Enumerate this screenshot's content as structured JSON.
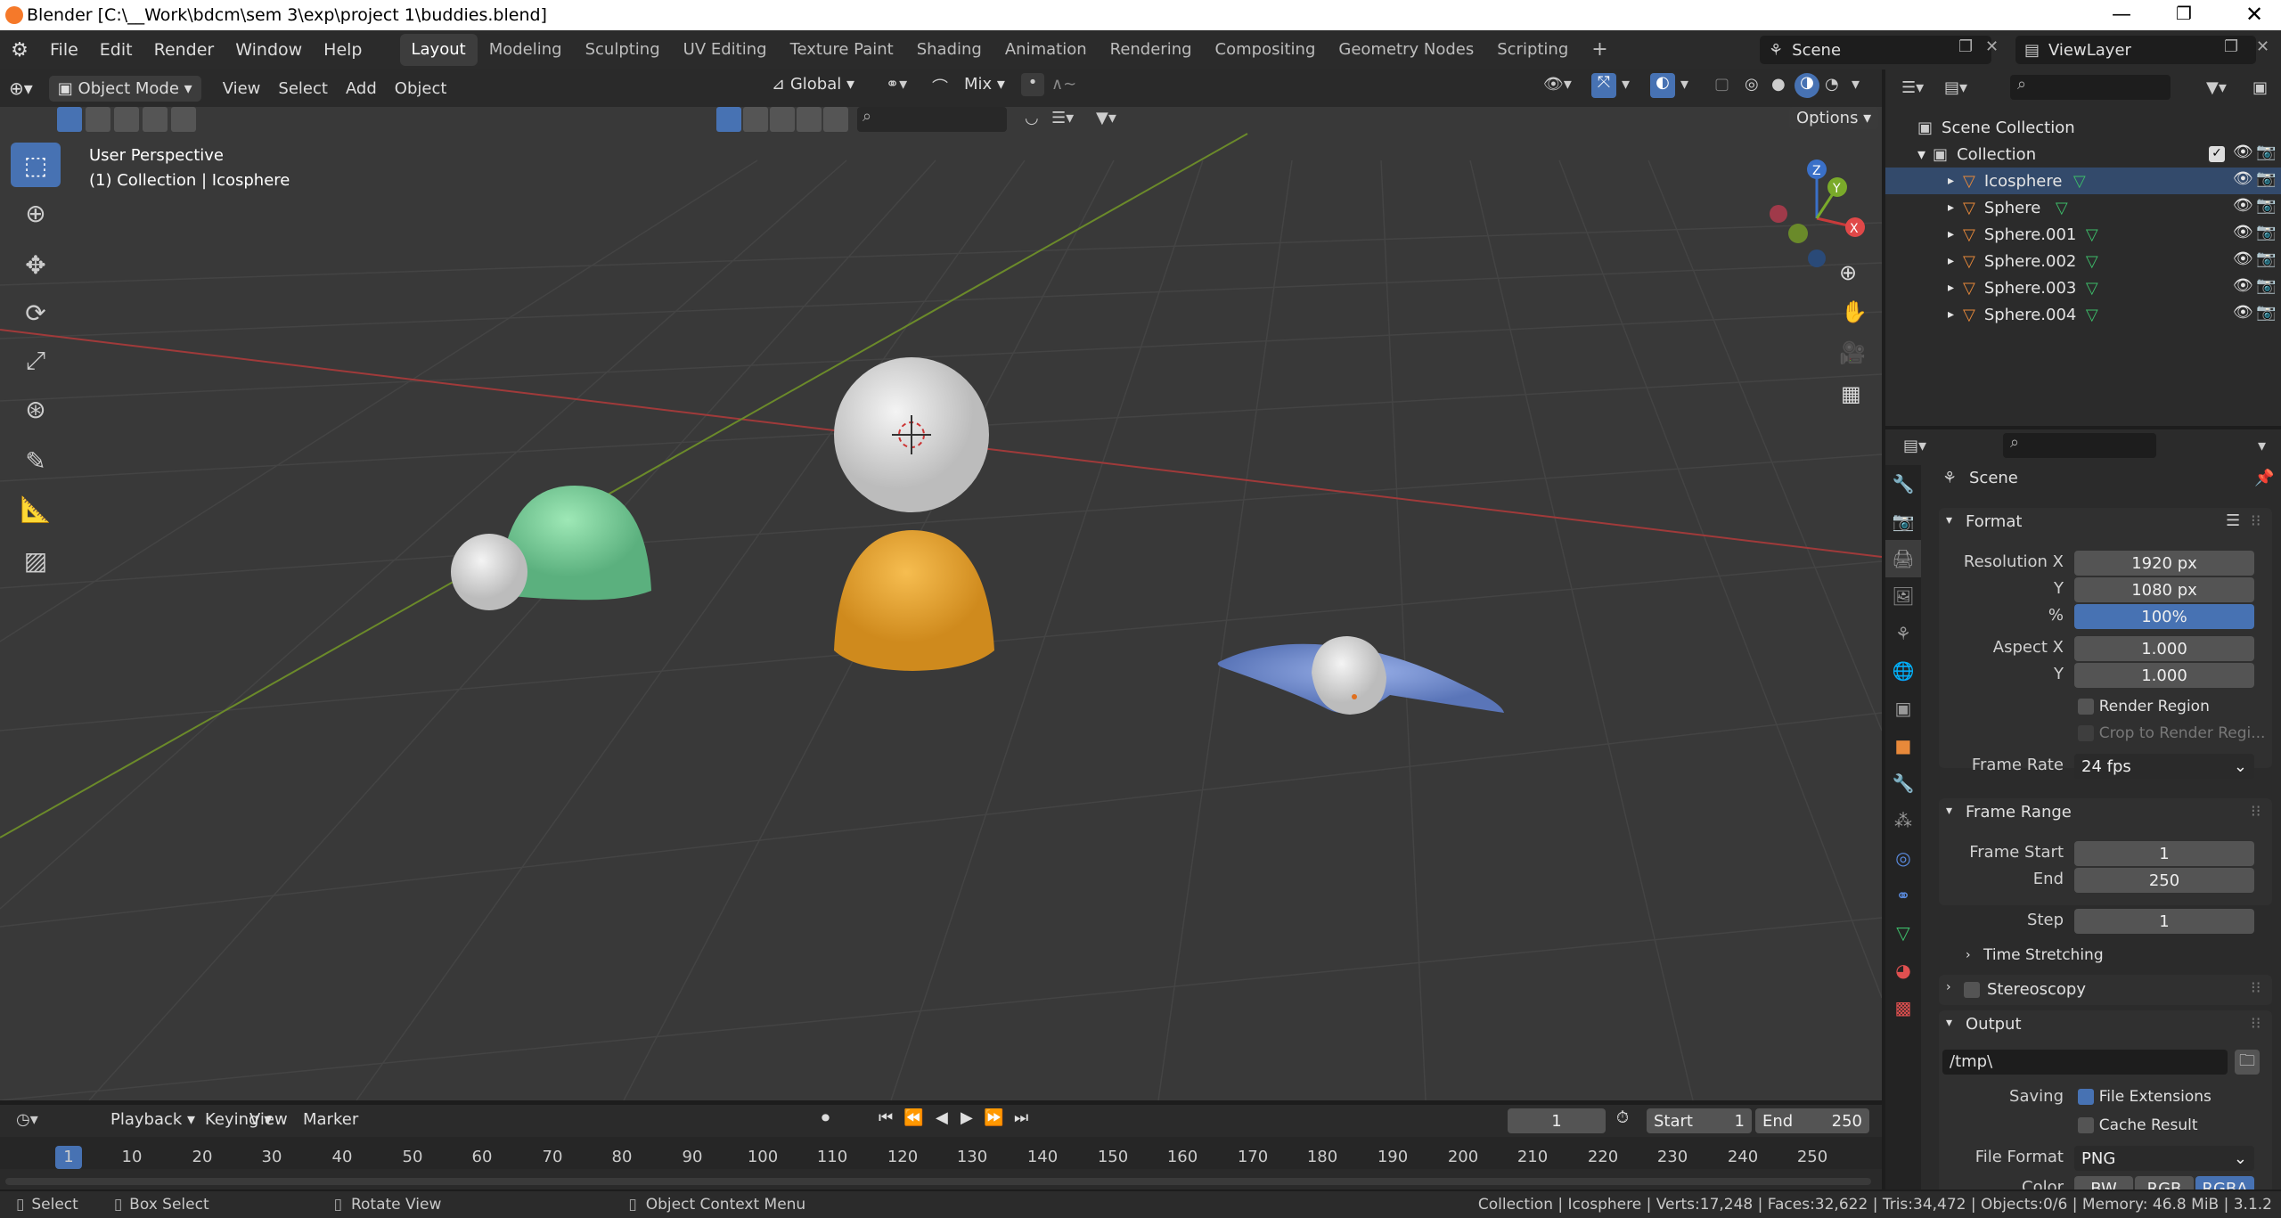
{
  "window": {
    "title": "Blender [C:\\__Work\\bdcm\\sem 3\\exp\\project 1\\buddies.blend]"
  },
  "menu": {
    "items": [
      "File",
      "Edit",
      "Render",
      "Window",
      "Help"
    ]
  },
  "workspaces": [
    "Layout",
    "Modeling",
    "Sculpting",
    "UV Editing",
    "Texture Paint",
    "Shading",
    "Animation",
    "Rendering",
    "Compositing",
    "Geometry Nodes",
    "Scripting"
  ],
  "scene_name": "Scene",
  "view_layer": "ViewLayer",
  "viewport": {
    "mode": "Object Mode",
    "menus": [
      "View",
      "Select",
      "Add",
      "Object"
    ],
    "transform": "Global",
    "snap": "Mix",
    "options": "Options",
    "perspective": "User Perspective",
    "context": "(1) Collection | Icosphere"
  },
  "outliner": {
    "scene_collection": "Scene Collection",
    "collection": "Collection",
    "objects": [
      "Icosphere",
      "Sphere",
      "Sphere.001",
      "Sphere.002",
      "Sphere.003",
      "Sphere.004"
    ]
  },
  "properties": {
    "scene": "Scene",
    "format_title": "Format",
    "resolution_x_label": "Resolution X",
    "resolution_x": "1920 px",
    "y_label": "Y",
    "resolution_y": "1080 px",
    "pct_label": "%",
    "pct": "100%",
    "aspect_x_label": "Aspect X",
    "aspect_x": "1.000",
    "aspect_y": "1.000",
    "render_region": "Render Region",
    "crop": "Crop to Render Regi...",
    "frame_rate_label": "Frame Rate",
    "frame_rate": "24 fps",
    "frame_range_title": "Frame Range",
    "frame_start_label": "Frame Start",
    "frame_start": "1",
    "end_label": "End",
    "end": "250",
    "step_label": "Step",
    "step": "1",
    "time_stretching": "Time Stretching",
    "stereoscopy": "Stereoscopy",
    "output_title": "Output",
    "output_path": "/tmp\\",
    "saving_label": "Saving",
    "file_extensions": "File Extensions",
    "cache_result": "Cache Result",
    "file_format_label": "File Format",
    "file_format": "PNG",
    "color_label": "Color",
    "color_modes": [
      "BW",
      "RGB",
      "RGBA"
    ]
  },
  "timeline": {
    "menus": [
      "Playback",
      "Keying",
      "View",
      "Marker"
    ],
    "current_frame": "1",
    "start_label": "Start",
    "start": "1",
    "end_label": "End",
    "end": "250",
    "ticks": [
      "1",
      "10",
      "20",
      "30",
      "40",
      "50",
      "60",
      "70",
      "80",
      "90",
      "100",
      "110",
      "120",
      "130",
      "140",
      "150",
      "160",
      "170",
      "180",
      "190",
      "200",
      "210",
      "220",
      "230",
      "240",
      "250"
    ]
  },
  "status": {
    "select": "Select",
    "box_select": "Box Select",
    "rotate": "Rotate View",
    "context_menu": "Object Context Menu",
    "info": "Collection | Icosphere | Verts:17,248 | Faces:32,622 | Tris:34,472 | Objects:0/6 | Memory: 46.8 MiB | 3.1.2"
  },
  "colors": {
    "accent": "#4772b3",
    "viewport_bg": "#393939",
    "green_sphere": "#7fd3a0",
    "orange_dome": "#e8a53a",
    "blue_blob": "#7a95d6"
  }
}
